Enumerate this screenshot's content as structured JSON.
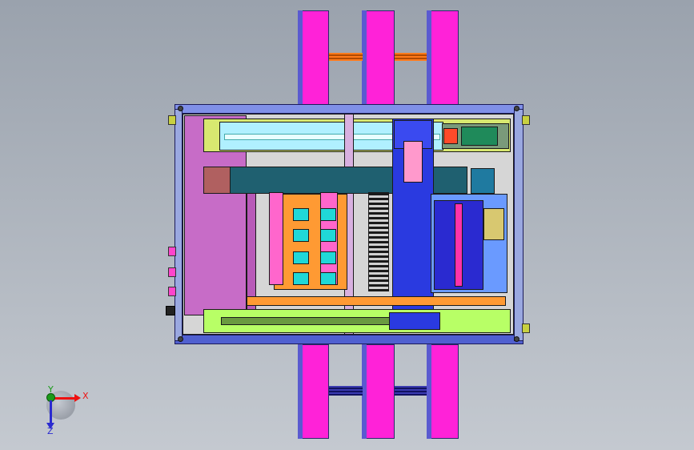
{
  "viewport": {
    "background_top": "#9aa2ad",
    "background_bottom": "#c4c9d0"
  },
  "model": {
    "rail_color": "#ff22d8",
    "frame_color": "#6a7ae0",
    "base_plate_color": "#c76cc7",
    "rail_plate_color": "#b8ff66",
    "cylinder_color": "#1f6070",
    "carriage_color": "#2a3ae0"
  },
  "triad": {
    "x_label": "X",
    "y_label": "Y",
    "z_label": "Z",
    "x_color": "#e11",
    "y_color": "#1a9a1a",
    "z_color": "#2a2ad0"
  }
}
